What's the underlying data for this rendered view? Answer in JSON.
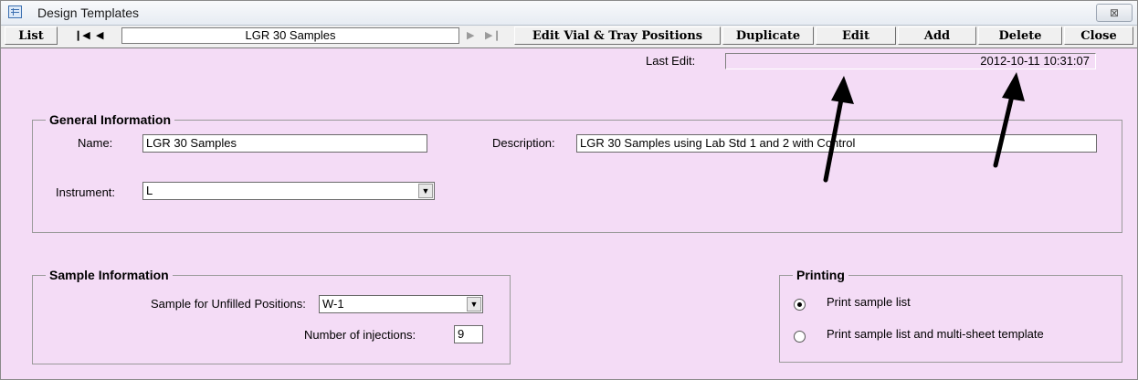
{
  "window": {
    "title": "Design Templates",
    "close_glyph": "⊠"
  },
  "nav": {
    "list_label": "List",
    "first_glyph": "❙◀",
    "prev_glyph": "◀",
    "record_value": "LGR 30 Samples",
    "next_glyph": "▶",
    "last_glyph": "▶❙",
    "edit_vial_label": "Edit Vial & Tray Positions",
    "duplicate_label": "Duplicate",
    "edit_label": "Edit",
    "add_label": "Add",
    "delete_label": "Delete",
    "close_label": "Close"
  },
  "last_edit": {
    "label": "Last Edit:",
    "value": "2012-10-11 10:31:07"
  },
  "general": {
    "title": "General Information",
    "name_label": "Name:",
    "name_value": "LGR 30 Samples",
    "description_label": "Description:",
    "description_value": "LGR 30 Samples using Lab Std 1 and 2 with Control",
    "instrument_label": "Instrument:",
    "instrument_value": "L"
  },
  "sample": {
    "title": "Sample Information",
    "unfilled_label": "Sample for Unfilled Positions:",
    "unfilled_value": "W-1",
    "injections_label": "Number of injections:",
    "injections_value": "9"
  },
  "printing": {
    "title": "Printing",
    "options": [
      {
        "label": "Print sample list",
        "checked": true
      },
      {
        "label": "Print sample list and multi-sheet template",
        "checked": false
      }
    ]
  },
  "annotation_color": "#000000"
}
